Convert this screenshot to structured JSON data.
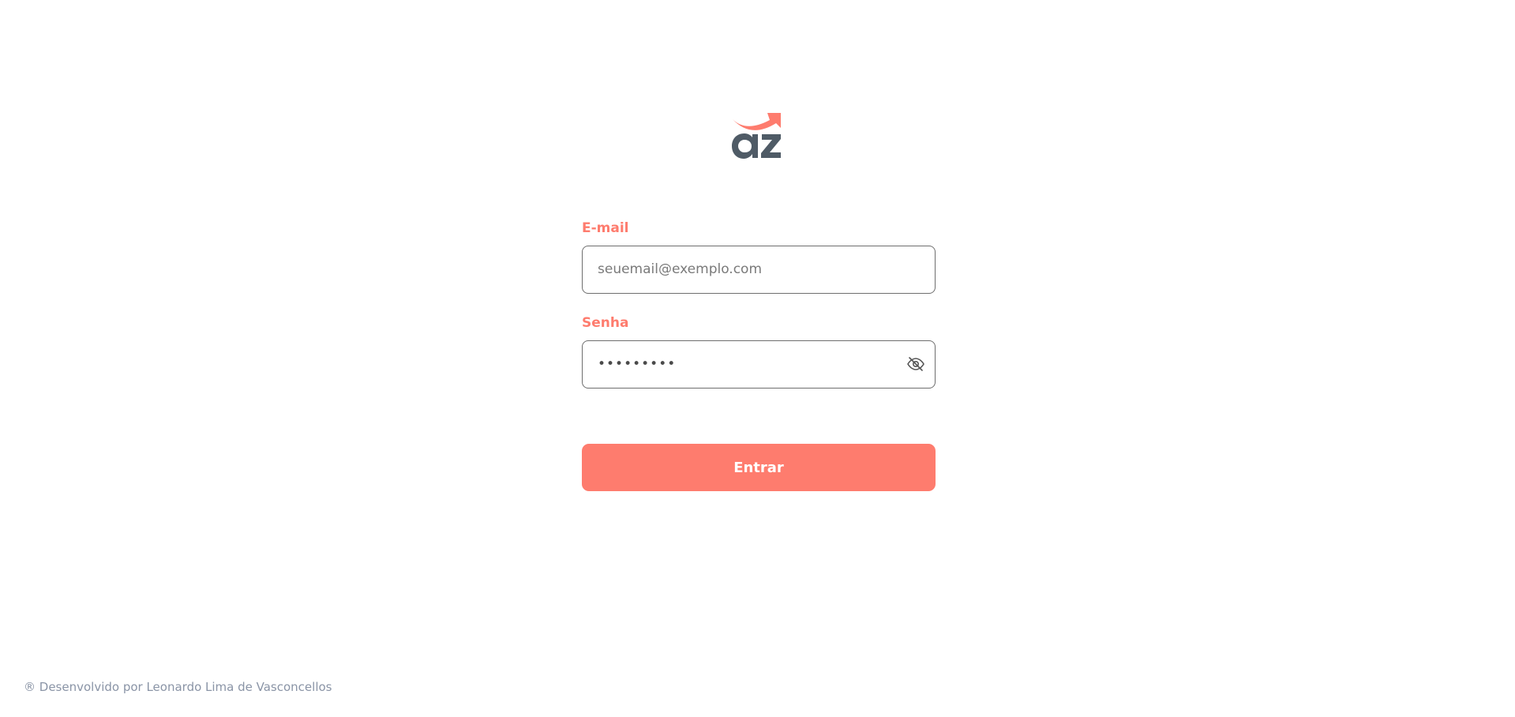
{
  "brand": {
    "logo_icon": "az-logo-icon",
    "logo_text": "az",
    "accent_color": "#fe7c6e",
    "text_color": "#4f5b66"
  },
  "form": {
    "email_label": "E-mail",
    "email_placeholder": "seuemail@exemplo.com",
    "email_value": "",
    "password_label": "Senha",
    "password_value": "•••••••••",
    "password_toggle_icon": "eye-off-icon",
    "submit_label": "Entrar"
  },
  "footer": {
    "credit": "® Desenvolvido por Leonardo Lima de Vasconcellos"
  }
}
